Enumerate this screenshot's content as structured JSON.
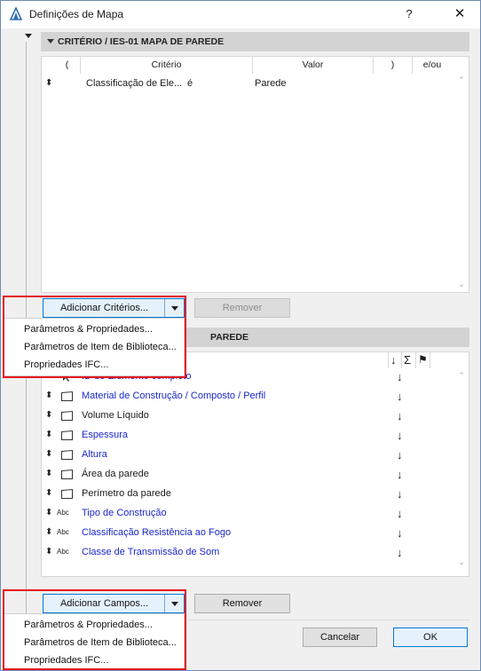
{
  "window": {
    "title": "Definições de Mapa",
    "help_label": "?",
    "close_label": "✕"
  },
  "criteria_section": {
    "header": "CRITÉRIO / IES-01 MAPA DE PAREDE",
    "columns": [
      "(",
      "Critério",
      "Valor",
      ")",
      "e/ou"
    ],
    "rows": [
      {
        "drag": "⬍",
        "criterion": "Classificação de Ele...",
        "operator": "é",
        "value": "Parede"
      }
    ],
    "add_button": "Adicionar Critérios...",
    "remove_button": "Remover"
  },
  "criteria_menu": {
    "items": [
      "Parâmetros & Propriedades...",
      "Parâmetros de Item de Biblioteca...",
      "Propriedades IFC..."
    ]
  },
  "fields_section": {
    "header_visible": "PAREDE",
    "column_icons": [
      "↓",
      "Σ",
      "⚑"
    ],
    "rows": [
      {
        "name": "ID de Elemento completo",
        "blue": true,
        "icon": "cursor",
        "arrow": "↓"
      },
      {
        "name": "Material de Construção / Composto / Perfil",
        "blue": true,
        "icon": "box",
        "arrow": "↓"
      },
      {
        "name": "Volume Líquido",
        "blue": false,
        "icon": "box",
        "arrow": "↓"
      },
      {
        "name": "Espessura",
        "blue": true,
        "icon": "box",
        "arrow": "↓"
      },
      {
        "name": "Altura",
        "blue": true,
        "icon": "box",
        "arrow": "↓"
      },
      {
        "name": "Área da parede",
        "blue": false,
        "icon": "box",
        "arrow": "↓"
      },
      {
        "name": "Perímetro da parede",
        "blue": false,
        "icon": "box",
        "arrow": "↓"
      },
      {
        "name": "Tipo de Construção",
        "blue": true,
        "icon": "abc",
        "arrow": "↓"
      },
      {
        "name": "Classificação Resistência ao Fogo",
        "blue": true,
        "icon": "abc",
        "arrow": "↓"
      },
      {
        "name": "Classe de Transmissão de Som",
        "blue": true,
        "icon": "abc",
        "arrow": "↓"
      }
    ],
    "drag_glyph": "⬍",
    "abc_label": "Abc",
    "add_button": "Adicionar Campos...",
    "remove_button": "Remover"
  },
  "fields_menu": {
    "items": [
      "Parâmetros & Propriedades...",
      "Parâmetros de Item de Biblioteca...",
      "Propriedades IFC..."
    ]
  },
  "footer": {
    "cancel": "Cancelar",
    "ok": "OK"
  },
  "colors": {
    "highlight": "#e5141e",
    "accent": "#0078d7",
    "link_blue": "#1a27c9"
  }
}
